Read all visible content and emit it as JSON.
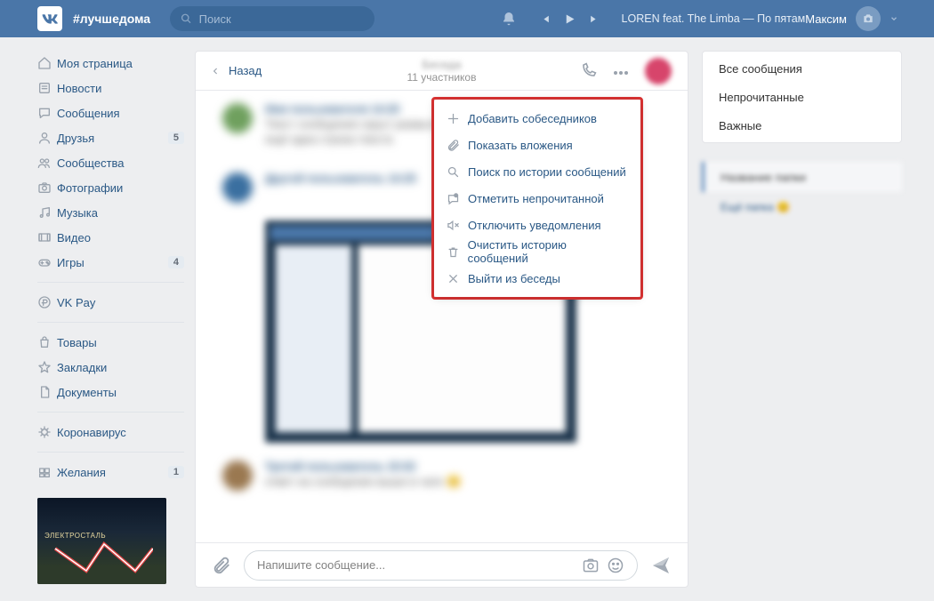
{
  "header": {
    "hashtag": "#лучшедома",
    "search_placeholder": "Поиск",
    "track": "LOREN feat. The Limba — По пятам",
    "username": "Максим"
  },
  "nav": {
    "items": [
      {
        "label": "Моя страница",
        "icon": "home"
      },
      {
        "label": "Новости",
        "icon": "news"
      },
      {
        "label": "Сообщения",
        "icon": "chat"
      },
      {
        "label": "Друзья",
        "icon": "user",
        "badge": "5"
      },
      {
        "label": "Сообщества",
        "icon": "users"
      },
      {
        "label": "Фотографии",
        "icon": "camera"
      },
      {
        "label": "Музыка",
        "icon": "music"
      },
      {
        "label": "Видео",
        "icon": "video"
      },
      {
        "label": "Игры",
        "icon": "game",
        "badge": "4"
      }
    ],
    "items2": [
      {
        "label": "VK Pay",
        "icon": "pay"
      }
    ],
    "items3": [
      {
        "label": "Товары",
        "icon": "bag"
      },
      {
        "label": "Закладки",
        "icon": "star"
      },
      {
        "label": "Документы",
        "icon": "doc"
      }
    ],
    "items4": [
      {
        "label": "Коронавирус",
        "icon": "virus"
      }
    ],
    "items5": [
      {
        "label": "Желания",
        "icon": "gift",
        "badge": "1"
      }
    ],
    "promo_text": "ЭЛЕКТРОСТАЛЬ"
  },
  "chat": {
    "back": "Назад",
    "participants": "11 участников",
    "compose_placeholder": "Напишите сообщение..."
  },
  "menu": {
    "items": [
      {
        "label": "Добавить собеседников",
        "icon": "plus"
      },
      {
        "label": "Показать вложения",
        "icon": "attach"
      },
      {
        "label": "Поиск по истории сообщений",
        "icon": "search"
      },
      {
        "label": "Отметить непрочитанной",
        "icon": "unread"
      },
      {
        "label": "Отключить уведомления",
        "icon": "mute"
      },
      {
        "label": "Очистить историю сообщений",
        "icon": "trash"
      },
      {
        "label": "Выйти из беседы",
        "icon": "leave"
      }
    ]
  },
  "filters": {
    "items": [
      "Все сообщения",
      "Непрочитанные",
      "Важные"
    ]
  }
}
